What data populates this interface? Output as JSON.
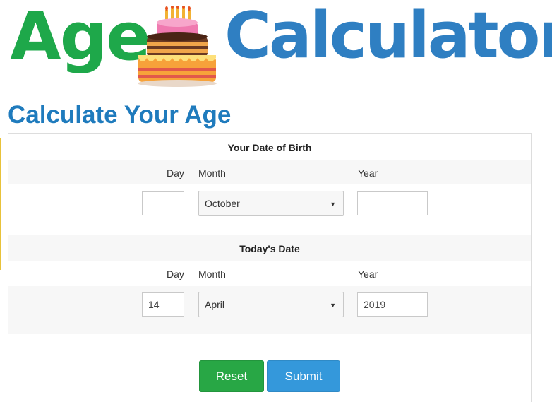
{
  "logo": {
    "word_left": "Age",
    "word_right": "Calculator",
    "cake_icon": "birthday-cake-icon"
  },
  "heading": "Calculate Your Age",
  "birth": {
    "title": "Your Date of Birth",
    "day_label": "Day",
    "month_label": "Month",
    "year_label": "Year",
    "day_value": "",
    "month_value": "October",
    "year_value": ""
  },
  "today": {
    "title": "Today's Date",
    "day_label": "Day",
    "month_label": "Month",
    "year_label": "Year",
    "day_value": "14",
    "month_value": "April",
    "year_value": "2019"
  },
  "buttons": {
    "reset": "Reset",
    "submit": "Submit"
  },
  "colors": {
    "age_green": "#1ea84a",
    "calc_blue": "#2f7fc2",
    "heading_blue": "#1f7bbd",
    "reset_green": "#28a745",
    "submit_blue": "#3498db"
  }
}
